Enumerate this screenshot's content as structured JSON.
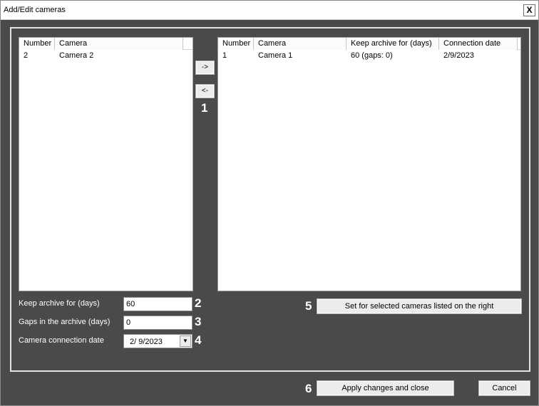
{
  "window": {
    "title": "Add/Edit cameras",
    "close_label": "X"
  },
  "left_list": {
    "columns": [
      "Number",
      "Camera"
    ],
    "rows": [
      [
        "2",
        "Camera 2"
      ]
    ]
  },
  "right_list": {
    "columns": [
      "Number",
      "Camera",
      "Keep archive for (days)",
      "Connection date"
    ],
    "rows": [
      [
        "1",
        "Camera 1",
        "60 (gaps: 0)",
        "2/9/2023"
      ]
    ]
  },
  "move_buttons": {
    "add_label": "->",
    "remove_label": "<-"
  },
  "form": {
    "keep_label": "Keep archive for (days)",
    "keep_value": "60",
    "gaps_label": "Gaps in the archive (days)",
    "gaps_value": "0",
    "date_label": "Camera connection date",
    "date_value": "2/  9/2023",
    "date_drop": "▼"
  },
  "set_button_label": "Set for selected cameras listed on the right",
  "footer": {
    "apply_label": "Apply changes and close",
    "cancel_label": "Cancel"
  },
  "callouts": {
    "c1": "1",
    "c2": "2",
    "c3": "3",
    "c4": "4",
    "c5": "5",
    "c6": "6"
  }
}
